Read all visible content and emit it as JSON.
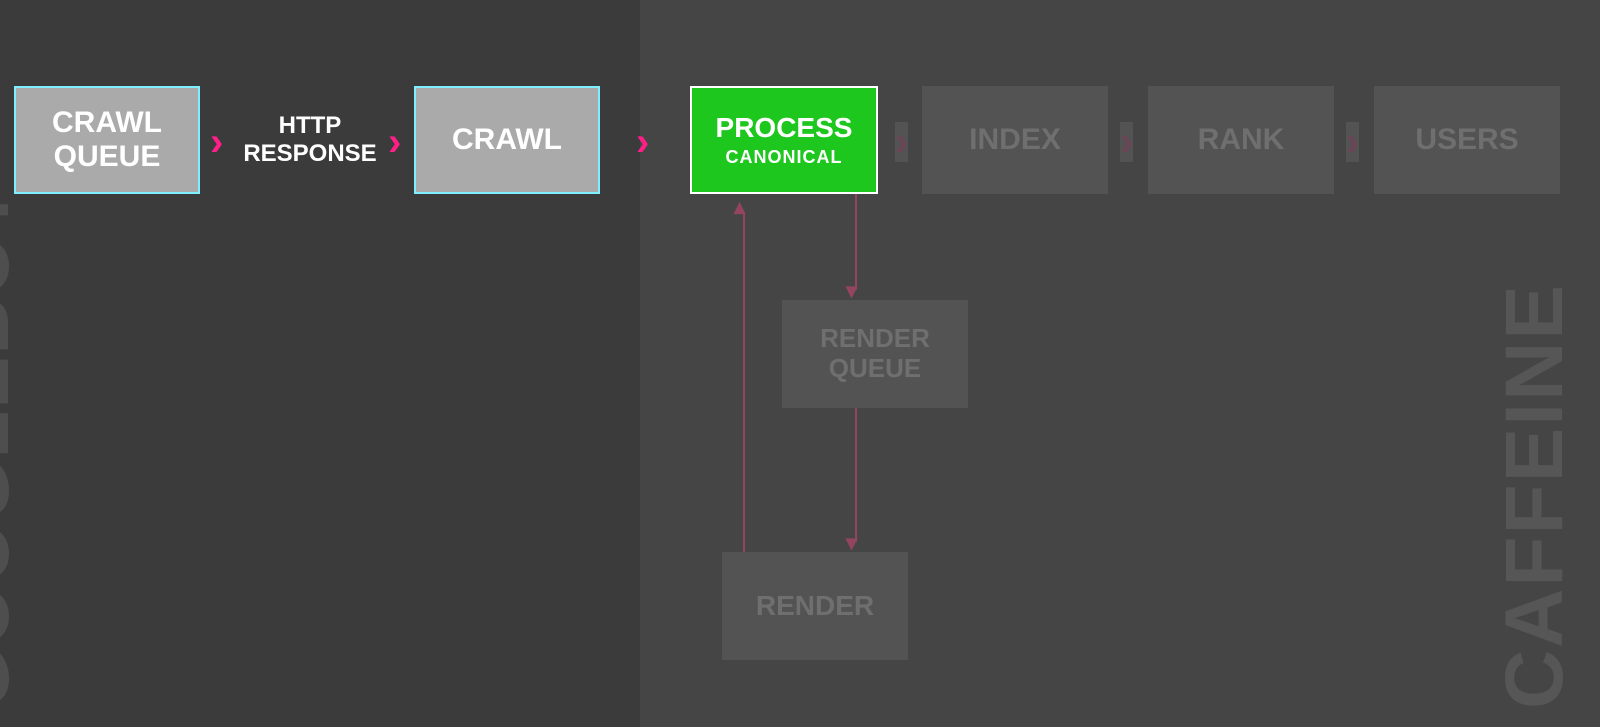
{
  "regions": {
    "left_label": "GOOGLEBOT",
    "right_label": "CAFFEINE"
  },
  "nodes": {
    "crawl_queue": {
      "title": "CRAWL QUEUE"
    },
    "http_response": {
      "title": "HTTP RESPONSE"
    },
    "crawl": {
      "title": "CRAWL"
    },
    "process": {
      "title": "PROCESS",
      "sub": "CANONICAL"
    },
    "index": {
      "title": "INDEX"
    },
    "rank": {
      "title": "RANK"
    },
    "users": {
      "title": "USERS"
    },
    "render_queue": {
      "title": "RENDER QUEUE"
    },
    "render": {
      "title": "RENDER"
    }
  },
  "glyphs": {
    "arrow_right": "›",
    "arrow_down": "▾",
    "arrow_up": "▴"
  },
  "colors": {
    "pink": "#ff1f87",
    "dim_pink": "#93445f",
    "green": "#1ec71e",
    "light_box": "#aaaaaa",
    "light_border": "#7defff",
    "dim_box": "#535353",
    "bg_left": "#3b3b3b",
    "bg_right": "#454545"
  }
}
